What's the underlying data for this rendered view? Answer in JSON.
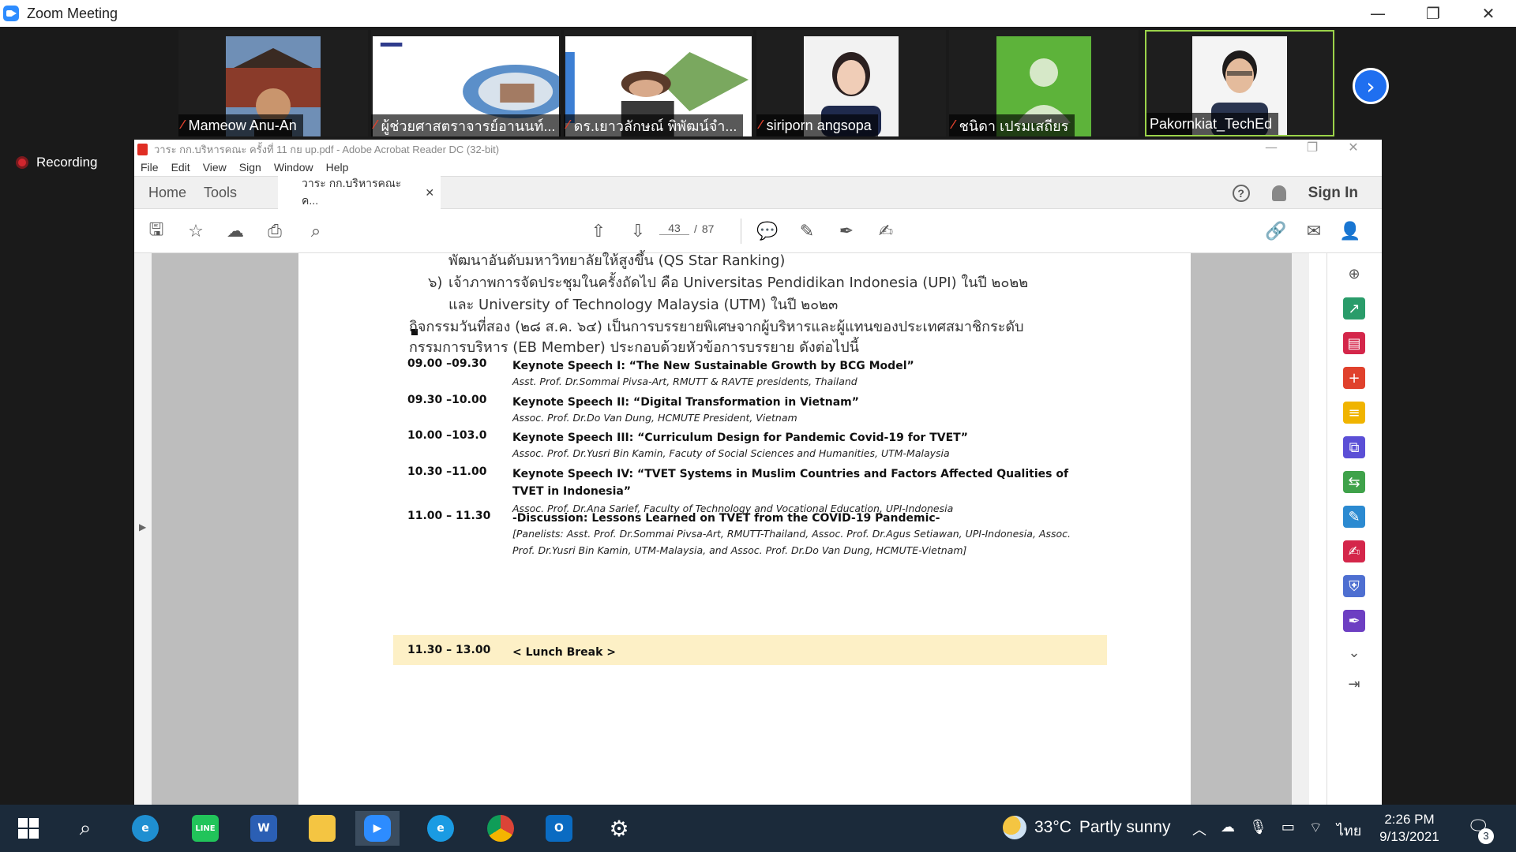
{
  "zoom": {
    "title": "Zoom Meeting",
    "recording_label": "Recording",
    "participants": [
      {
        "name": "Mameow Anu-An",
        "muted": true
      },
      {
        "name": "ผู้ช่วยศาสตราจารย์อานนท์...",
        "muted": true
      },
      {
        "name": "ดร.เยาวลักษณ์ พิพัฒน์จำ...",
        "muted": true
      },
      {
        "name": "siriporn angsopa",
        "muted": true
      },
      {
        "name": "ชนิดา เปรมเสถียร",
        "muted": true
      },
      {
        "name": "Pakornkiat_TechEd",
        "muted": false
      }
    ]
  },
  "acrobat": {
    "title": "วาระ กก.บริหารคณะ ครั้งที่ 11 กย up.pdf - Adobe Acrobat Reader DC (32-bit)",
    "menu": [
      "File",
      "Edit",
      "View",
      "Sign",
      "Window",
      "Help"
    ],
    "tabs": {
      "home": "Home",
      "tools": "Tools",
      "doc": "วาระ กก.บริหารคณะ ค..."
    },
    "sign_in": "Sign In",
    "help_glyph": "?",
    "page_current": "43",
    "page_sep": "/",
    "page_total": "87"
  },
  "document": {
    "lines": {
      "line0": "พัฒนาอันดับมหาวิทยาลัยให้สูงขึ้น (QS Star Ranking)",
      "line1_num": "๖)",
      "line1": "เจ้าภาพการจัดประชุมในครั้งถัดไป คือ Universitas Pendidikan Indonesia (UPI) ในปี ๒๐๒๒",
      "line2": "และ University of Technology Malaysia (UTM) ในปี ๒๐๒๓",
      "line3": "กิจกรรมวันที่สอง (๒๘ ส.ค. ๖๔) เป็นการบรรยายพิเศษจากผู้บริหารและผู้แทนของประเทศสมาชิกระดับ",
      "line4": "กรรมการบริหาร (EB Member) ประกอบด้วยหัวข้อการบรรยาย ดังต่อไปนี้"
    },
    "schedule": [
      {
        "time": "09.00 –09.30",
        "title": "Keynote Speech I: “The New Sustainable Growth by BCG Model”",
        "sub": "Asst. Prof. Dr.Sommai Pivsa-Art, RMUTT & RAVTE presidents, Thailand"
      },
      {
        "time": "09.30 –10.00",
        "title": "Keynote Speech II: “Digital Transformation in Vietnam”",
        "sub": "Assoc. Prof. Dr.Do Van Dung, HCMUTE President, Vietnam"
      },
      {
        "time": "10.00 –103.0",
        "title": "Keynote Speech III: “Curriculum Design for Pandemic Covid-19 for TVET”",
        "sub": "Assoc. Prof. Dr.Yusri Bin Kamin, Facuty of Social Sciences and Humanities, UTM-Malaysia"
      },
      {
        "time": "10.30 –11.00",
        "title": "Keynote Speech IV: “TVET Systems in Muslim Countries and Factors Affected Qualities of TVET in Indonesia”",
        "sub": "Assoc. Prof. Dr.Ana Sarief, Faculty of Technology and Vocational Education, UPI-Indonesia"
      },
      {
        "time": "11.00 – 11.30",
        "title": "-Discussion: Lessons Learned on TVET from the COVID-19 Pandemic-",
        "sub": "[Panelists: Asst. Prof. Dr.Sommai Pivsa-Art, RMUTT-Thailand, Assoc. Prof. Dr.Agus Setiawan, UPI-Indonesia, Assoc. Prof. Dr.Yusri Bin Kamin, UTM-Malaysia, and Assoc. Prof. Dr.Do Van Dung, HCMUTE-Vietnam]"
      },
      {
        "time": "11.30 – 13.00",
        "title": "< Lunch Break >",
        "sub": ""
      }
    ]
  },
  "taskbar": {
    "weather_temp": "33°C",
    "weather_text": "Partly sunny",
    "lang": "ไทย",
    "time": "2:26 PM",
    "date": "9/13/2021",
    "notifications": "3"
  },
  "colors": {
    "zoom_blue": "#2d8cff",
    "active_speaker": "#9bd34a",
    "lunch_band": "#fdf0c6",
    "taskbar": "#1b2a3a"
  }
}
